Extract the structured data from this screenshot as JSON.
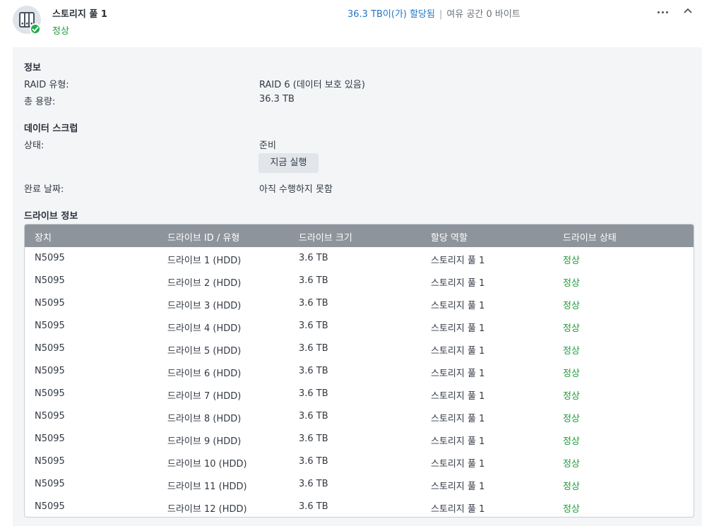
{
  "pool": {
    "title": "스토리지 풀 1",
    "status": "정상",
    "allocated": "36.3 TB이(가) 할당됨",
    "separator": "|",
    "free_space": "여유 공간 0 바이트",
    "more_icon": "more-horizontal-icon",
    "collapse_icon": "chevron-up-icon"
  },
  "info": {
    "section_title": "정보",
    "raid_label": "RAID 유형:",
    "raid_value": "RAID 6 (데이터 보호 있음)",
    "capacity_label": "총 용량:",
    "capacity_value": "36.3 TB"
  },
  "scrub": {
    "section_title": "데이터 스크럽",
    "status_label": "상태:",
    "status_value": "준비",
    "run_button": "지금 실행",
    "completed_label": "완료 날짜:",
    "completed_value": "아직 수행하지 못함"
  },
  "drives": {
    "section_title": "드라이브 정보",
    "columns": [
      "장치",
      "드라이브 ID / 유형",
      "드라이브 크기",
      "할당 역할",
      "드라이브 상태"
    ],
    "rows": [
      [
        "N5095",
        "드라이브 1 (HDD)",
        "3.6 TB",
        "스토리지 풀 1",
        "정상"
      ],
      [
        "N5095",
        "드라이브 2 (HDD)",
        "3.6 TB",
        "스토리지 풀 1",
        "정상"
      ],
      [
        "N5095",
        "드라이브 3 (HDD)",
        "3.6 TB",
        "스토리지 풀 1",
        "정상"
      ],
      [
        "N5095",
        "드라이브 4 (HDD)",
        "3.6 TB",
        "스토리지 풀 1",
        "정상"
      ],
      [
        "N5095",
        "드라이브 5 (HDD)",
        "3.6 TB",
        "스토리지 풀 1",
        "정상"
      ],
      [
        "N5095",
        "드라이브 6 (HDD)",
        "3.6 TB",
        "스토리지 풀 1",
        "정상"
      ],
      [
        "N5095",
        "드라이브 7 (HDD)",
        "3.6 TB",
        "스토리지 풀 1",
        "정상"
      ],
      [
        "N5095",
        "드라이브 8 (HDD)",
        "3.6 TB",
        "스토리지 풀 1",
        "정상"
      ],
      [
        "N5095",
        "드라이브 9 (HDD)",
        "3.6 TB",
        "스토리지 풀 1",
        "정상"
      ],
      [
        "N5095",
        "드라이브 10 (HDD)",
        "3.6 TB",
        "스토리지 풀 1",
        "정상"
      ],
      [
        "N5095",
        "드라이브 11 (HDD)",
        "3.6 TB",
        "스토리지 풀 1",
        "정상"
      ],
      [
        "N5095",
        "드라이브 12 (HDD)",
        "3.6 TB",
        "스토리지 풀 1",
        "정상"
      ]
    ]
  },
  "colors": {
    "ok_green": "#1f9a3b",
    "link_blue": "#1f78c8",
    "table_header": "#8d949c",
    "panel_bg": "#f3f5f7"
  }
}
